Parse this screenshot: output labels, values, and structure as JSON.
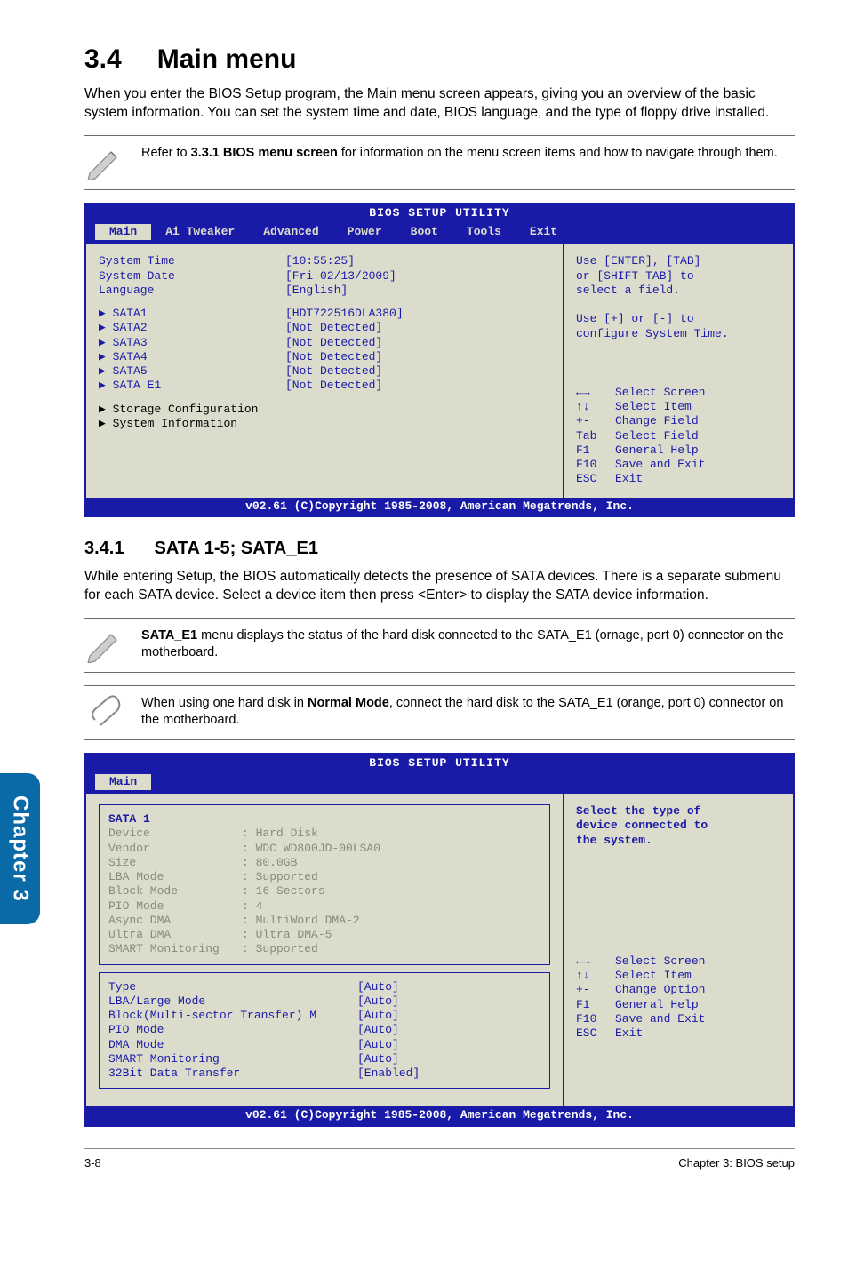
{
  "sidetab": "Chapter 3",
  "section": {
    "num": "3.4",
    "title": "Main menu"
  },
  "intro": "When you enter the BIOS Setup program, the Main menu screen appears, giving you an overview of the basic system information. You can set the system time and date, BIOS language, and the type of floppy drive installed.",
  "note1_prefix": "Refer to ",
  "note1_bold": "3.3.1 BIOS menu screen",
  "note1_suffix": " for information on the menu screen items and how to navigate through them.",
  "bios1": {
    "title": "BIOS SETUP UTILITY",
    "tabs": [
      "Main",
      "Ai Tweaker",
      "Advanced",
      "Power",
      "Boot",
      "Tools",
      "Exit"
    ],
    "active_tab": "Main",
    "rows_top": [
      {
        "label": "System Time",
        "value": "[10:55:25]"
      },
      {
        "label": "System Date",
        "value": "[Fri 02/13/2009]"
      },
      {
        "label": "Language",
        "value": "[English]"
      }
    ],
    "sata": [
      {
        "label": "SATA1",
        "value": "[HDT722516DLA380]"
      },
      {
        "label": "SATA2",
        "value": "[Not Detected]"
      },
      {
        "label": "SATA3",
        "value": "[Not Detected]"
      },
      {
        "label": "SATA4",
        "value": "[Not Detected]"
      },
      {
        "label": "SATA5",
        "value": "[Not Detected]"
      },
      {
        "label": "SATA E1",
        "value": "[Not Detected]"
      }
    ],
    "black_items": [
      "Storage Configuration",
      "System Information"
    ],
    "help_top": [
      "Use [ENTER], [TAB]",
      "or [SHIFT-TAB] to",
      "select a field.",
      "",
      "Use [+] or [-] to",
      "configure System Time."
    ],
    "help_keys": [
      {
        "k": "←→",
        "t": "Select Screen"
      },
      {
        "k": "↑↓",
        "t": "Select Item"
      },
      {
        "k": "+-",
        "t": "Change Field"
      },
      {
        "k": "Tab",
        "t": "Select Field"
      },
      {
        "k": "F1",
        "t": "General Help"
      },
      {
        "k": "F10",
        "t": "Save and Exit"
      },
      {
        "k": "ESC",
        "t": "Exit"
      }
    ],
    "footer": "v02.61 (C)Copyright 1985-2008, American Megatrends, Inc."
  },
  "subsection": {
    "num": "3.4.1",
    "title": "SATA 1-5; SATA_E1"
  },
  "sub_body": "While entering Setup, the BIOS automatically detects the presence of SATA devices. There is a separate submenu for each SATA device. Select a device item then press <Enter> to display the SATA device information.",
  "note2_bold": "SATA_E1",
  "note2_rest": " menu displays the status of the hard disk connected to the SATA_E1 (ornage, port 0) connector on the motherboard.",
  "note3_pre": "When using one hard disk in ",
  "note3_bold": "Normal Mode",
  "note3_post": ", connect the hard disk to the SATA_E1 (orange, port 0) connector on the motherboard.",
  "bios2": {
    "title": "BIOS SETUP UTILITY",
    "active_tab": "Main",
    "heading": "SATA 1",
    "info": [
      {
        "label": "Device",
        "value": ": Hard Disk"
      },
      {
        "label": "Vendor",
        "value": ": WDC WD800JD-00LSA0"
      },
      {
        "label": "Size",
        "value": ": 80.0GB"
      },
      {
        "label": "LBA Mode",
        "value": ": Supported"
      },
      {
        "label": "Block Mode",
        "value": ": 16 Sectors"
      },
      {
        "label": "PIO Mode",
        "value": ": 4"
      },
      {
        "label": "Async DMA",
        "value": ": MultiWord DMA-2"
      },
      {
        "label": "Ultra DMA",
        "value": ": Ultra DMA-5"
      },
      {
        "label": "SMART Monitoring",
        "value": ": Supported"
      }
    ],
    "settings": [
      {
        "label": "Type",
        "value": "[Auto]"
      },
      {
        "label": "LBA/Large Mode",
        "value": "[Auto]"
      },
      {
        "label": "Block(Multi-sector Transfer) M",
        "value": "[Auto]"
      },
      {
        "label": "PIO Mode",
        "value": "[Auto]"
      },
      {
        "label": "DMA Mode",
        "value": "[Auto]"
      },
      {
        "label": "SMART Monitoring",
        "value": "[Auto]"
      },
      {
        "label": "32Bit Data Transfer",
        "value": "[Enabled]"
      }
    ],
    "help_top": [
      "Select the type of",
      "device connected to",
      "the system."
    ],
    "help_keys": [
      {
        "k": "←→",
        "t": "Select Screen"
      },
      {
        "k": "↑↓",
        "t": "Select Item"
      },
      {
        "k": "+-",
        "t": "Change Option"
      },
      {
        "k": "F1",
        "t": "General Help"
      },
      {
        "k": "F10",
        "t": "Save and Exit"
      },
      {
        "k": "ESC",
        "t": "Exit"
      }
    ],
    "footer": "v02.61 (C)Copyright 1985-2008, American Megatrends, Inc."
  },
  "pagefoot": {
    "left": "3-8",
    "right": "Chapter 3: BIOS setup"
  }
}
